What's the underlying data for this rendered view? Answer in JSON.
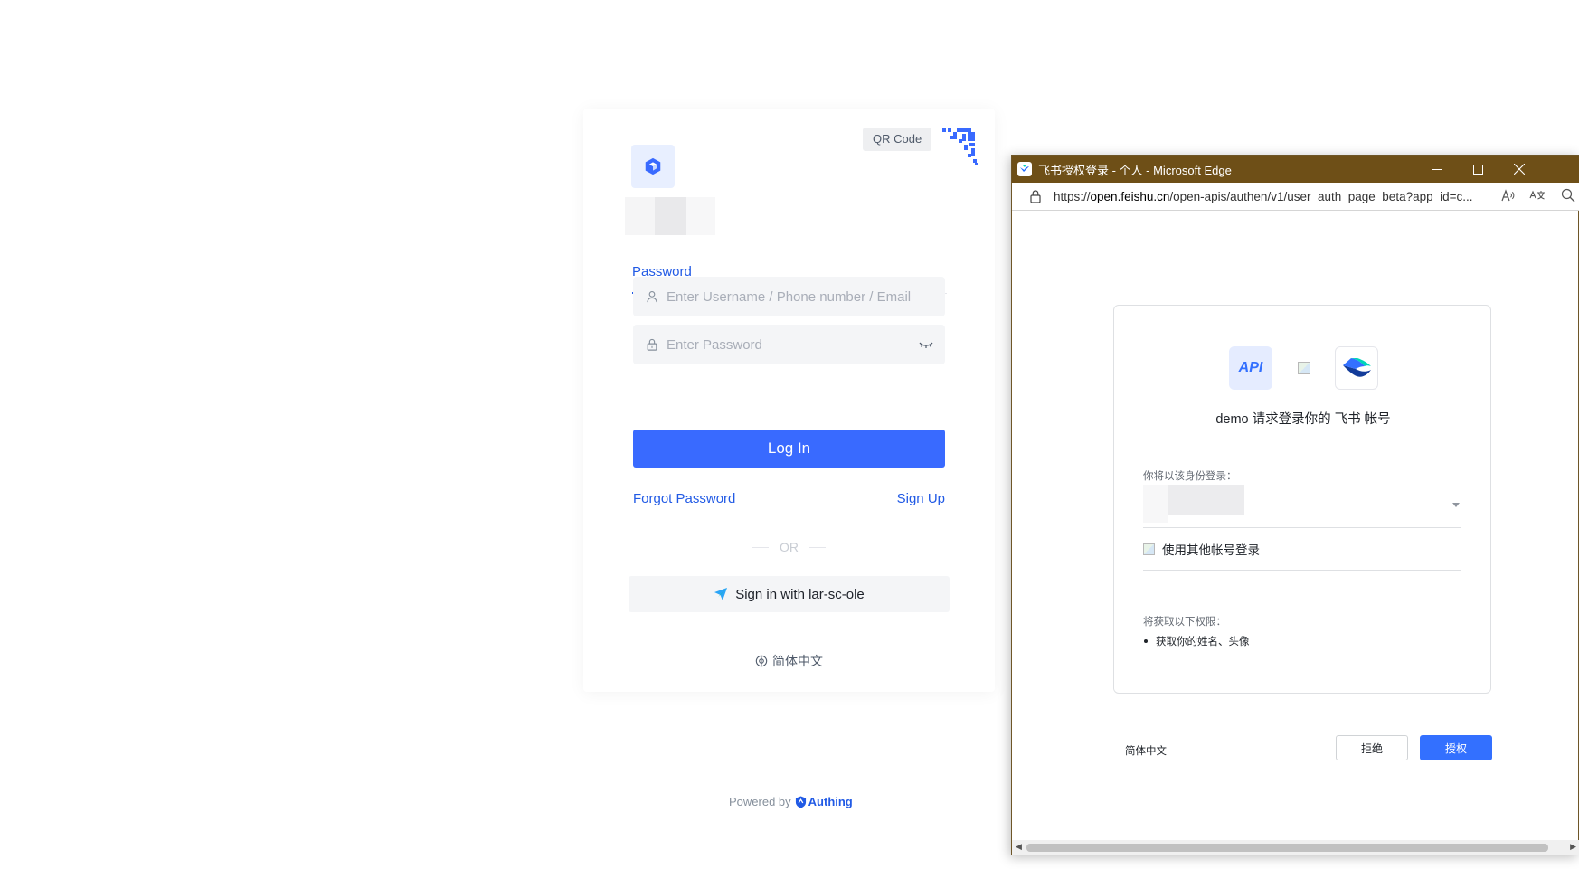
{
  "login": {
    "qr_tooltip": "QR Code",
    "tab_password": "Password",
    "username_placeholder": "Enter Username / Phone number / Email",
    "password_placeholder": "Enter Password",
    "login_button": "Log In",
    "forgot_password": "Forgot Password",
    "sign_up": "Sign Up",
    "or_text": "OR",
    "social_button": "Sign in with lar-sc-ole",
    "language": "简体中文",
    "accent_color": "#396aff"
  },
  "footer": {
    "powered_by": "Powered by",
    "brand": "Authing"
  },
  "popup": {
    "window_title": "飞书授权登录 - 个人 - Microsoft Edge",
    "url_prefix": "https://",
    "url_domain": "open.feishu.cn",
    "url_path": "/open-apis/authen/v1/user_auth_page_beta?app_id=c...",
    "api_logo_text": "API",
    "auth_request": "demo 请求登录你的 飞书 帐号",
    "identity_label": "你将以该身份登录：",
    "other_account": "使用其他帐号登录",
    "permissions_label": "将获取以下权限：",
    "permissions": [
      "获取你的姓名、头像"
    ],
    "footer_language": "简体中文",
    "reject_button": "拒绝",
    "grant_button": "授权",
    "titlebar_color": "#6e4f17",
    "primary_color": "#3370ff"
  }
}
